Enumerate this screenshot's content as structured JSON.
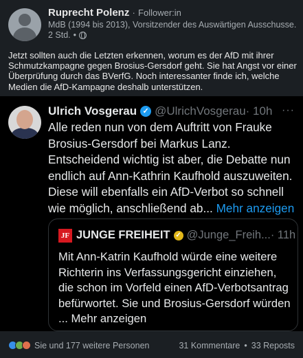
{
  "post": {
    "author": "Ruprecht Polenz",
    "separator": "·",
    "follower_label": "Follower:in",
    "headline": "MdB (1994 bis 2013), Vorsitzender des Auswärtigen Ausschusse...",
    "time": "2 Std.",
    "time_sep": "•",
    "commentary": "Jetzt sollten auch die Letzten erkennen, worum es der AfD mit ihrer Schmutzkampagne gegen Brosius-Gersdorf geht. Sie hat Angst vor einer Überprüfung durch das BVerfG. Noch interessanter finde ich, welche Medien die AfD-Kampagne deshalb unterstützen."
  },
  "quoted_tweet": {
    "name": "Ulrich Vosgerau",
    "handle": "@UlrichVosgerau",
    "time": "· 10h",
    "more": "···",
    "text": "Alle reden nun von dem Auftritt von Frauke Brosius-Gersdorf bei Markus Lanz. Entscheidend wichtig ist aber, die Debatte nun endlich auf Ann-Kathrin Kaufhold auszuweiten. Diese will ebenfalls ein AfD-Verbot so schnell wie möglich, anschließend ab...",
    "show_more": "Mehr anzeigen",
    "verified_glyph": "✓"
  },
  "inner_quote": {
    "logo_text": "JF",
    "name": "JUNGE FREIHEIT",
    "handle": "@Junge_Freih...",
    "time": "· 11h",
    "text": "Mit Ann-Katrin Kaufhold würde eine weitere Richterin ins Verfassungsgericht einziehen, die schon im Vorfeld einen AfD-Verbotsantrag befürwortet. Sie und Brosius-Gersdorf würden ...",
    "show_more": "Mehr anzeigen",
    "verified_glyph": "✓"
  },
  "footer": {
    "reactors": "Sie und 177 weitere Personen",
    "comments": "31 Kommentare",
    "dot": "•",
    "reposts": "33 Reposts"
  },
  "colors": {
    "background": "#1b1f23",
    "quote_background": "#000000",
    "link": "#1d9bf0",
    "verified_blue": "#1d9bf0",
    "verified_gold": "#e2b719",
    "jf_red": "#d71920"
  },
  "icons": [
    "globe-icon",
    "verified-badge-icon",
    "more-options-icon",
    "like-reaction-icon",
    "celebrate-reaction-icon",
    "love-reaction-icon"
  ]
}
